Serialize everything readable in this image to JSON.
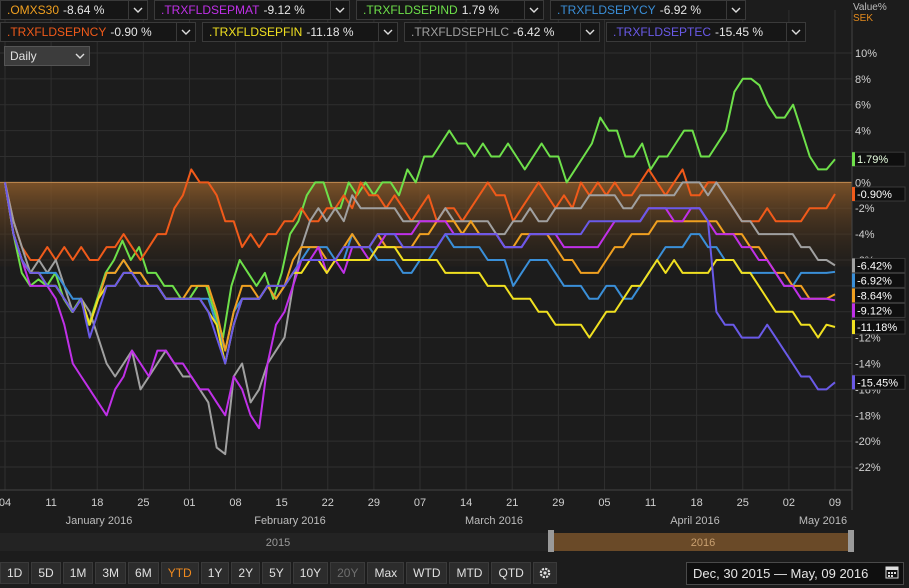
{
  "legend": [
    {
      "symbol": ".OMXS30",
      "value": "-8.64 %",
      "color": "#f0a020"
    },
    {
      "symbol": ".TRXFLDSEPMAT",
      "value": "-9.12 %",
      "color": "#c030e8"
    },
    {
      "symbol": ".TRXFLDSEPIND",
      "value": "1.79 %",
      "color": "#6ee04a"
    },
    {
      "symbol": ".TRXFLDSEPYCY",
      "value": "-6.92 %",
      "color": "#3a8fd8"
    },
    {
      "symbol": ".TRXFLDSEPNCY",
      "value": "-0.90 %",
      "color": "#f05a1a"
    },
    {
      "symbol": ".TRXFLDSEPFIN",
      "value": "-11.18 %",
      "color": "#f0e020"
    },
    {
      "symbol": ".TRXFLDSEPHLC",
      "value": "-6.42 %",
      "color": "#a0a0a0"
    },
    {
      "symbol": ".TRXFLDSEPTEC",
      "value": "-15.45 %",
      "color": "#6a5ae8"
    }
  ],
  "interval": "Daily",
  "unit": {
    "line1": "Value%",
    "line2": "SEK"
  },
  "toolbar": [
    "1D",
    "5D",
    "1M",
    "3M",
    "6M",
    "YTD",
    "1Y",
    "2Y",
    "5Y",
    "10Y",
    "20Y",
    "Max",
    "WTD",
    "MTD",
    "QTD"
  ],
  "toolbar_active": "YTD",
  "toolbar_disabled": "20Y",
  "date_range": "Dec, 30 2015 — May, 09 2016",
  "navigator": {
    "left_label": "2015",
    "right_label": "2016"
  },
  "chart_data": {
    "type": "line",
    "y_ticks": [
      "10%",
      "8%",
      "6%",
      "4%",
      "2%",
      "0%",
      "-2%",
      "-4%",
      "-6%",
      "-8%",
      "-10%",
      "-12%",
      "-14%",
      "-16%",
      "-18%",
      "-20%",
      "-22%"
    ],
    "ylim": [
      -23,
      11
    ],
    "x_day_labels": [
      "04",
      "11",
      "18",
      "25",
      "01",
      "08",
      "15",
      "22",
      "29",
      "07",
      "14",
      "21",
      "29",
      "05",
      "11",
      "18",
      "25",
      "02",
      "09"
    ],
    "x_month_labels": [
      "January 2016",
      "February 2016",
      "March 2016",
      "April 2016",
      "May 2016"
    ],
    "series": [
      {
        "name": ".TRXFLDSEPIND",
        "color": "#6ee04a",
        "badge": "1.79%",
        "last": 1.79,
        "values": [
          0,
          -4,
          -7,
          -8,
          -7.5,
          -8,
          -7,
          -9,
          -10,
          -9,
          -11,
          -9,
          -7,
          -6,
          -4.5,
          -6,
          -5,
          -7,
          -7,
          -8,
          -8,
          -9,
          -9,
          -8,
          -8,
          -10,
          -12,
          -8,
          -6,
          -7,
          -8,
          -7,
          -9,
          -7,
          -4,
          -3,
          -1,
          0,
          0,
          -2,
          -2,
          0,
          -1,
          0,
          -1,
          0,
          0,
          -1,
          1,
          0,
          2,
          2,
          3,
          4,
          3,
          3,
          2,
          3,
          2,
          2,
          3,
          2,
          1,
          2,
          3,
          2,
          2,
          0,
          1,
          2,
          3,
          5,
          4,
          4,
          2,
          2,
          3,
          1,
          2,
          2,
          3,
          4,
          4,
          2,
          2,
          3,
          4,
          7,
          8,
          8,
          7.5,
          6,
          5,
          5,
          6,
          4,
          2,
          1,
          1,
          1.79
        ]
      },
      {
        "name": ".TRXFLDSEPNCY",
        "color": "#f05a1a",
        "badge": "-0.90%",
        "last": -0.9,
        "values": [
          0,
          -3,
          -5,
          -6,
          -6,
          -5,
          -6,
          -5,
          -6,
          -5,
          -6,
          -6,
          -5,
          -5,
          -4,
          -5,
          -6,
          -5,
          -4,
          -4,
          -2,
          -1,
          1,
          0,
          0,
          -1,
          -3,
          -3,
          -5,
          -4,
          -5,
          -4,
          -4,
          -3,
          -3,
          -2,
          -3,
          -3,
          -2,
          -2,
          -1,
          -2,
          0,
          -1,
          -1,
          -2,
          -1,
          -2,
          -3,
          -2,
          -1,
          -3,
          -2,
          -2,
          -3,
          -2,
          -1,
          0,
          -1,
          -1,
          -3,
          -2,
          -1,
          0,
          -1,
          -2,
          -1,
          -2,
          0,
          -1,
          0,
          -1,
          0,
          -1,
          -1,
          0,
          1,
          0,
          -1,
          0,
          1,
          -1,
          -1,
          0,
          0,
          -1,
          -2,
          -3,
          -3,
          -3,
          -2,
          -3,
          -3,
          -3,
          -3,
          -2,
          -2,
          -2,
          -0.9
        ]
      },
      {
        "name": ".TRXFLDSEPHLC",
        "color": "#a0a0a0",
        "badge": "-6.42%",
        "last": -6.42,
        "values": [
          0,
          -3,
          -5,
          -7,
          -6,
          -7,
          -6,
          -8,
          -10,
          -9,
          -10,
          -12,
          -14,
          -15,
          -14,
          -13,
          -16,
          -15,
          -14,
          -13,
          -14,
          -15,
          -15,
          -16,
          -17,
          -20.5,
          -21,
          -15,
          -14,
          -17,
          -16,
          -14,
          -13,
          -12,
          -8,
          -5,
          -3,
          -2,
          -3,
          -2,
          -3,
          -1,
          -2,
          -2,
          -2,
          -2,
          -2,
          -3,
          -3,
          -3,
          -3,
          -3,
          -2,
          -3,
          -3,
          -3,
          -3,
          -3,
          -4,
          -4,
          -3,
          -3,
          -2,
          -3,
          -3,
          -2,
          -2,
          -2,
          -2,
          -1,
          -1,
          -1,
          -1,
          -2,
          -2,
          -1,
          -1,
          -1,
          -1,
          -1,
          0,
          0,
          0,
          -1,
          0,
          -1,
          -2,
          -3,
          -3,
          -4,
          -4,
          -4,
          -4,
          -4,
          -5,
          -5,
          -6,
          -6,
          -6.42
        ]
      },
      {
        "name": ".TRXFLDSEPYCY",
        "color": "#3a8fd8",
        "badge": "-6.92%",
        "last": -6.92,
        "values": [
          0,
          -4,
          -6,
          -7,
          -7,
          -7,
          -7,
          -8,
          -9,
          -9,
          -11,
          -9,
          -7,
          -7,
          -6,
          -7,
          -7,
          -8,
          -8,
          -9,
          -9,
          -9,
          -9,
          -9,
          -9,
          -11,
          -13,
          -10,
          -9,
          -9,
          -9,
          -8,
          -9,
          -8,
          -7,
          -6,
          -5,
          -5,
          -5,
          -6,
          -6,
          -4,
          -5,
          -5,
          -6,
          -6,
          -6,
          -7,
          -7,
          -6,
          -6,
          -5,
          -4,
          -5,
          -5,
          -5,
          -5,
          -6,
          -6,
          -6,
          -8,
          -7,
          -6,
          -6,
          -6,
          -7,
          -8,
          -8,
          -8,
          -9,
          -9,
          -8,
          -8,
          -9,
          -9,
          -8,
          -7,
          -6,
          -5,
          -5,
          -5,
          -4,
          -4,
          -5,
          -5,
          -6,
          -6,
          -7,
          -7,
          -7,
          -7,
          -7,
          -8,
          -8,
          -7,
          -7,
          -7,
          -7,
          -6.92
        ]
      },
      {
        "name": ".OMXS30",
        "color": "#f0a020",
        "badge": "-8.64%",
        "last": -8.64,
        "values": [
          0,
          -4,
          -6,
          -7,
          -7,
          -8,
          -8,
          -9,
          -10,
          -9,
          -11,
          -9,
          -7,
          -7,
          -6,
          -7,
          -7,
          -8,
          -8,
          -9,
          -9,
          -9,
          -8,
          -8,
          -8,
          -10,
          -13,
          -10,
          -8,
          -8,
          -9,
          -8,
          -9,
          -8,
          -6,
          -5,
          -5,
          -5,
          -6,
          -6,
          -5,
          -4,
          -5,
          -5,
          -4,
          -5,
          -5,
          -5,
          -5,
          -4,
          -4,
          -3,
          -3,
          -3,
          -4,
          -3,
          -4,
          -4,
          -4,
          -5,
          -5,
          -4,
          -4,
          -4,
          -4,
          -5,
          -6,
          -6,
          -7,
          -7,
          -7,
          -6,
          -5,
          -5,
          -4,
          -4,
          -4,
          -3,
          -3,
          -3,
          -3,
          -3,
          -3,
          -3,
          -3,
          -4,
          -4,
          -4,
          -5,
          -5,
          -6,
          -7,
          -7,
          -8,
          -8,
          -9,
          -9,
          -9,
          -8.64
        ]
      },
      {
        "name": ".TRXFLDSEPMAT",
        "color": "#c030e8",
        "badge": "-9.12%",
        "last": -9.12,
        "values": [
          0,
          -4,
          -6,
          -8,
          -8,
          -8,
          -9,
          -11,
          -14,
          -15,
          -16,
          -17,
          -18,
          -16,
          -15,
          -13,
          -14,
          -15,
          -13,
          -13,
          -14,
          -14,
          -15,
          -16,
          -16,
          -17,
          -18,
          -15,
          -16,
          -18,
          -19,
          -14,
          -11,
          -10,
          -8,
          -6,
          -6,
          -5,
          -7,
          -6,
          -7,
          -5,
          -5,
          -6,
          -5,
          -4,
          -4,
          -4,
          -4,
          -3,
          -3,
          -3,
          -3,
          -4,
          -4,
          -4,
          -4,
          -4,
          -4,
          -5,
          -5,
          -5,
          -4,
          -4,
          -4,
          -4,
          -5,
          -5,
          -5,
          -5,
          -5,
          -4,
          -3,
          -3,
          -3,
          -3,
          -2,
          -2,
          -2,
          -3,
          -3,
          -2,
          -2,
          -3,
          -4,
          -4,
          -4,
          -5,
          -5,
          -6,
          -6,
          -7,
          -8,
          -8,
          -9,
          -9,
          -9,
          -9,
          -9.12
        ]
      },
      {
        "name": ".TRXFLDSEPFIN",
        "color": "#f0e020",
        "badge": "-11.18%",
        "last": -11.18,
        "values": [
          0,
          -4,
          -6,
          -7,
          -7,
          -8,
          -8,
          -9,
          -10,
          -9,
          -11,
          -9,
          -8,
          -8,
          -7,
          -7,
          -8,
          -8,
          -8,
          -9,
          -9,
          -9,
          -9,
          -9,
          -10,
          -11,
          -14,
          -11,
          -9,
          -9,
          -9,
          -8,
          -8,
          -8,
          -7,
          -7,
          -6,
          -6,
          -7,
          -6,
          -6,
          -6,
          -6,
          -6,
          -5,
          -5,
          -5,
          -6,
          -6,
          -6,
          -6,
          -6,
          -7,
          -7,
          -7,
          -7,
          -7,
          -8,
          -8,
          -8,
          -9,
          -9,
          -9,
          -10,
          -10,
          -11,
          -11,
          -11,
          -11,
          -12,
          -11,
          -10,
          -10,
          -9,
          -8,
          -8,
          -7,
          -6,
          -7,
          -6,
          -7,
          -7,
          -7,
          -7,
          -6,
          -6,
          -6,
          -7,
          -7,
          -8,
          -9,
          -10,
          -10,
          -10,
          -11,
          -11,
          -12,
          -11,
          -11.18
        ]
      },
      {
        "name": ".TRXFLDSEPTEC",
        "color": "#6a5ae8",
        "badge": "-15.45%",
        "last": -15.45,
        "values": [
          0,
          -4,
          -6,
          -7,
          -7,
          -8,
          -8,
          -9,
          -10,
          -9,
          -12,
          -10,
          -8,
          -8,
          -7,
          -7,
          -8,
          -8,
          -8,
          -9,
          -9,
          -9,
          -9,
          -9,
          -10,
          -12,
          -14,
          -11,
          -9,
          -9,
          -9,
          -8,
          -8,
          -8,
          -7,
          -6,
          -6,
          -6,
          -6,
          -6,
          -5,
          -5,
          -5,
          -5,
          -4,
          -4,
          -4,
          -5,
          -5,
          -5,
          -5,
          -5,
          -4,
          -4,
          -4,
          -4,
          -4,
          -4,
          -4,
          -5,
          -5,
          -5,
          -4,
          -4,
          -4,
          -4,
          -4,
          -4,
          -4,
          -3,
          -3,
          -3,
          -3,
          -3,
          -3,
          -3,
          -2,
          -2,
          -2,
          -2,
          -2,
          -2,
          -2,
          -3,
          -10,
          -11,
          -11,
          -12,
          -12,
          -12,
          -11,
          -12,
          -13,
          -14,
          -15,
          -15,
          -16,
          -16,
          -15.45
        ]
      }
    ]
  }
}
